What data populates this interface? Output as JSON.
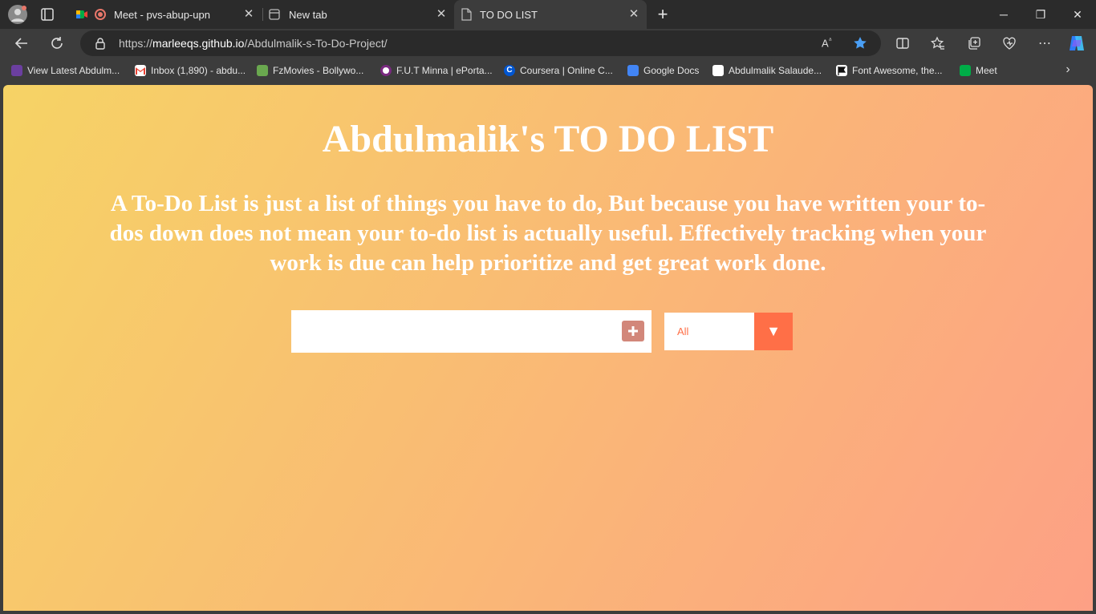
{
  "tabs": [
    {
      "title": "Meet - pvs-abup-upn",
      "active": false
    },
    {
      "title": "New tab",
      "active": false
    },
    {
      "title": "TO DO LIST",
      "active": true
    }
  ],
  "address": {
    "scheme": "https://",
    "host": "marleeqs.github.io",
    "path": "/Abdulmalik-s-To-Do-Project/"
  },
  "bookmarks": [
    {
      "label": "View Latest Abdulm...",
      "color": "#6b3fa0"
    },
    {
      "label": "Inbox (1,890) - abdu...",
      "color": "#ea4335"
    },
    {
      "label": "FzMovies - Bollywo...",
      "color": "#6aa84f"
    },
    {
      "label": "F.U.T Minna | ePorta...",
      "color": "#ffffff"
    },
    {
      "label": "Coursera | Online C...",
      "color": "#0056d2"
    },
    {
      "label": "Google Docs",
      "color": "#4285f4"
    },
    {
      "label": "Abdulmalik Salaude...",
      "color": "#ffffff"
    },
    {
      "label": "Font Awesome, the...",
      "color": "#ffffff"
    },
    {
      "label": "Meet",
      "color": "#00ac47"
    }
  ],
  "page": {
    "title": "Abdulmalik's TO DO LIST",
    "description": "A To-Do List is just a list of things you have to do, But because you have written your to-dos down does not mean your to-do list is actually useful. Effectively tracking when your work is due can help prioritize and get great work done.",
    "input_value": "",
    "filter_value": "All"
  },
  "colors": {
    "gradient_start": "#f6d365",
    "gradient_end": "#fda085",
    "accent": "#ff6f47",
    "add_button": "#d2877a"
  }
}
